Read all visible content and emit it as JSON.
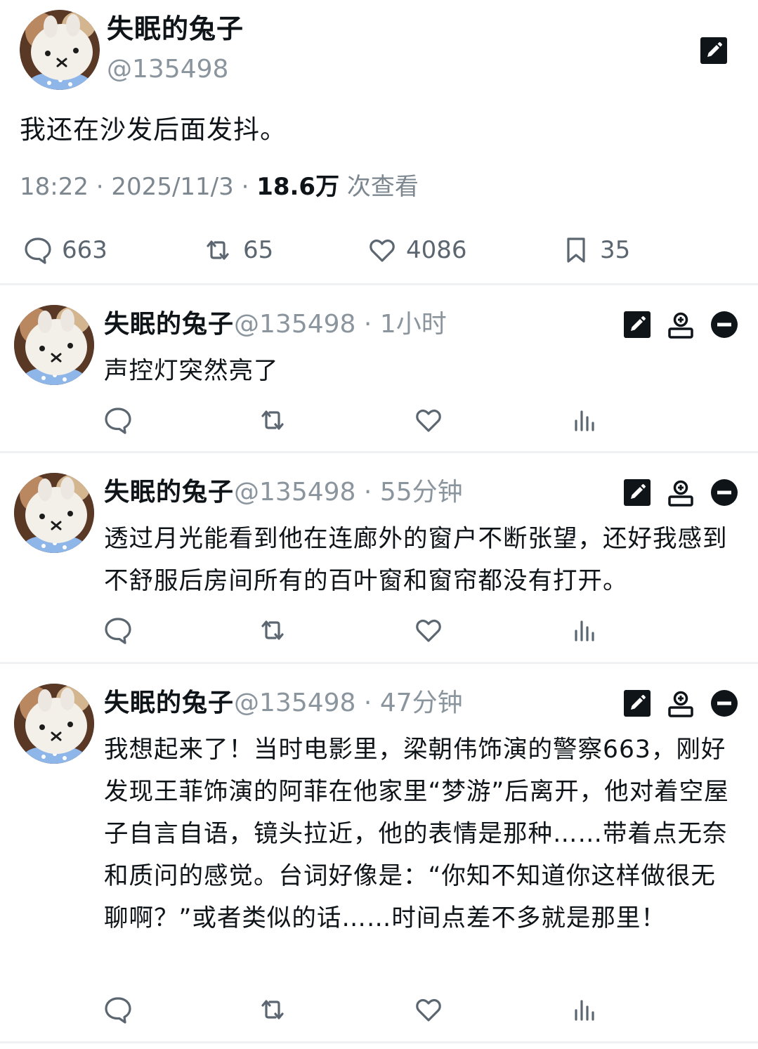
{
  "post": {
    "author_name": "失眠的兔子",
    "handle": "@135498",
    "text": "我还在沙发后面发抖。",
    "time": "18:22",
    "date": "2025/11/3",
    "views": "18.6万",
    "views_label": "次查看",
    "stats": {
      "replies": "663",
      "reposts": "65",
      "likes": "4086",
      "bookmarks": "35"
    }
  },
  "replies": [
    {
      "author_name": "失眠的兔子",
      "handle": "@135498",
      "time_ago": "1小时",
      "text": "声控灯突然亮了"
    },
    {
      "author_name": "失眠的兔子",
      "handle": "@135498",
      "time_ago": "55分钟",
      "text": "透过月光能看到他在连廊外的窗户不断张望，还好我感到不舒服后房间所有的百叶窗和窗帘都没有打开。"
    },
    {
      "author_name": "失眠的兔子",
      "handle": "@135498",
      "time_ago": "47分钟",
      "text": "我想起来了！当时电影里，梁朝伟饰演的警察663，刚好发现王菲饰演的阿菲在他家里“梦游”后离开，他对着空屋子自言自语，镜头拉近，他的表情是那种……带着点无奈和质问的感觉。台词好像是：“你知不知道你这样做很无聊啊？”或者类似的话……时间点差不多就是那里！"
    }
  ],
  "separator": "·",
  "icons": [
    "edit-icon",
    "add-user-icon",
    "remove-icon",
    "comment-icon",
    "repost-icon",
    "like-icon",
    "bookmark-icon",
    "views-icon"
  ],
  "colors": {
    "text": "#0f1419",
    "secondary": "#8b959e",
    "divider": "#eff1f3"
  }
}
